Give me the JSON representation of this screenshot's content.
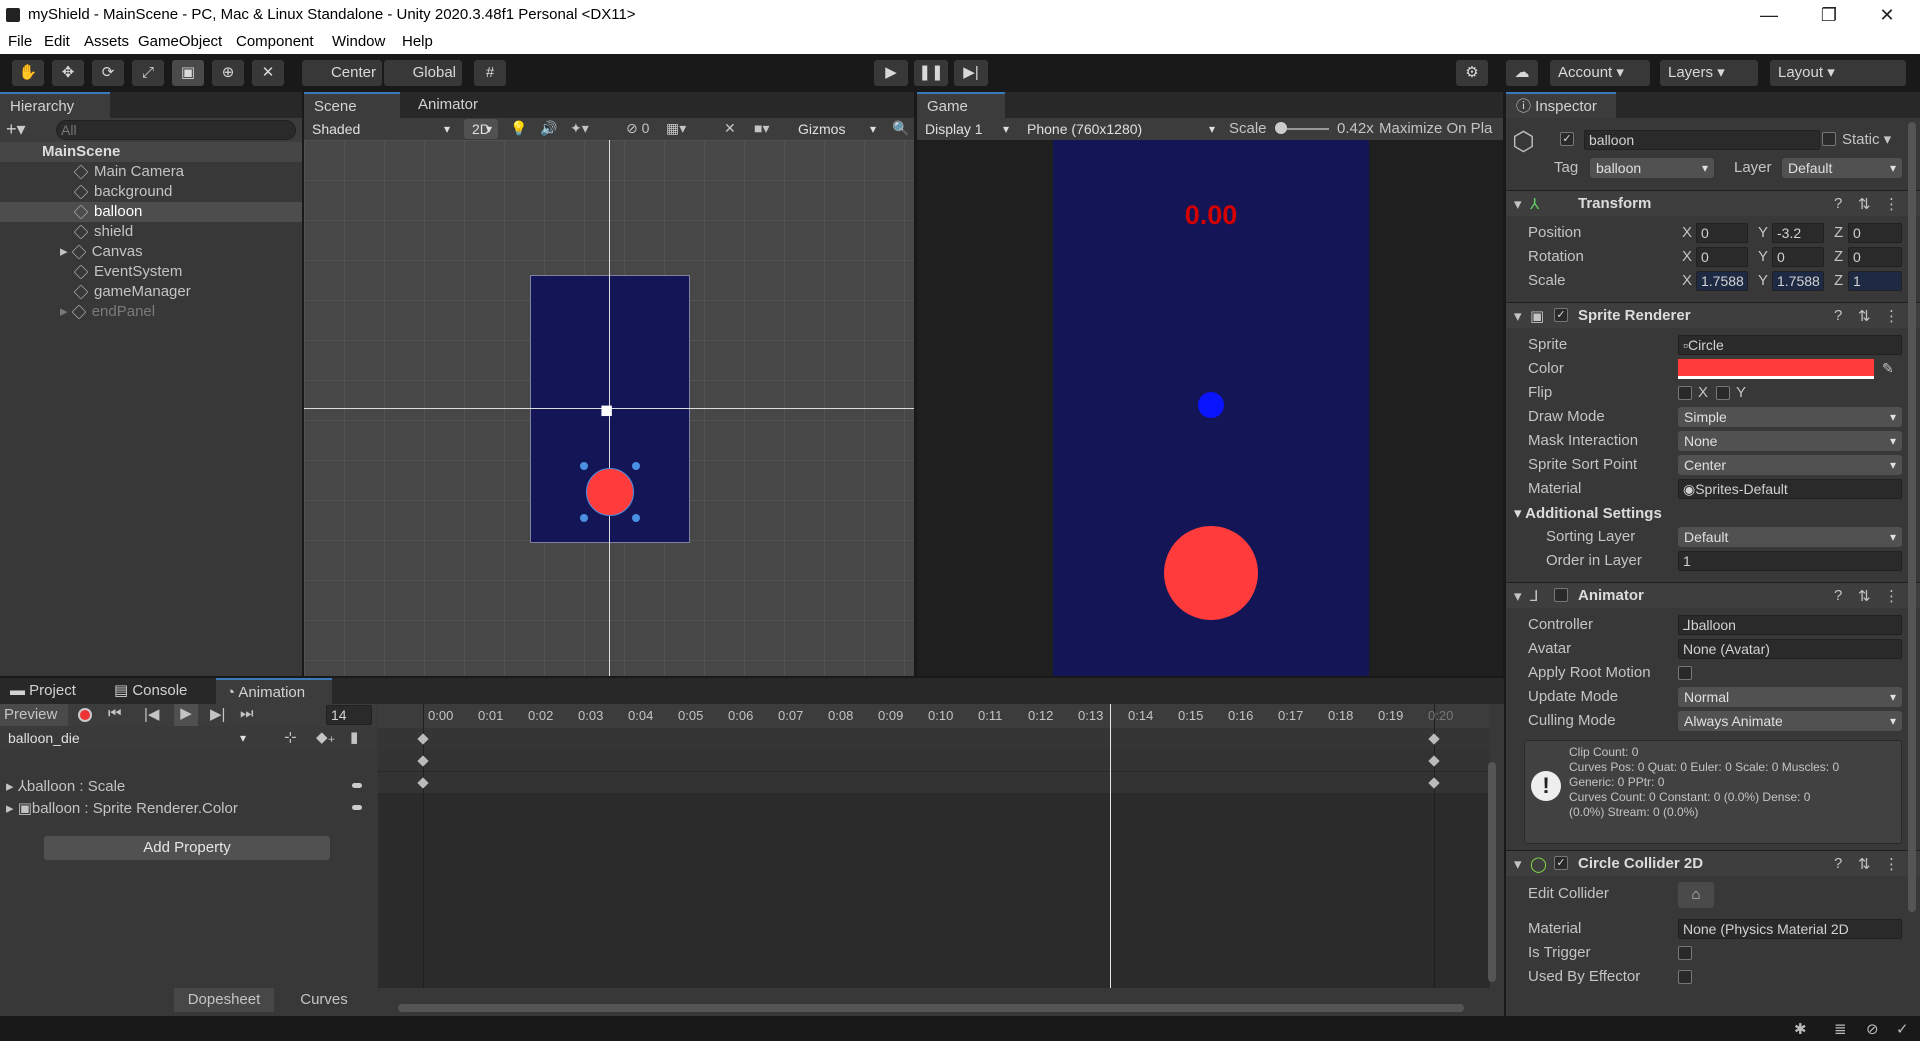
{
  "window": {
    "title": "myShield - MainScene - PC, Mac & Linux Standalone - Unity 2020.3.48f1 Personal <DX11>",
    "min": "—",
    "max": "❐",
    "close": "✕"
  },
  "menu": [
    "File",
    "Edit",
    "Assets",
    "GameObject",
    "Component",
    "Window",
    "Help"
  ],
  "toolbar": {
    "center": "Center",
    "global": "Global",
    "account": "Account",
    "layers": "Layers",
    "layout": "Layout"
  },
  "hierarchy": {
    "tab": "Hierarchy",
    "search_placeholder": "All",
    "scene": "MainScene",
    "items": [
      "Main Camera",
      "background",
      "balloon",
      "shield",
      "Canvas",
      "EventSystem",
      "gameManager",
      "endPanel"
    ]
  },
  "scene": {
    "tab": "Scene",
    "animator_tab": "Animator",
    "shading": "Shaded",
    "mode2d": "2D",
    "hidden_count": "0",
    "gizmos": "Gizmos"
  },
  "game": {
    "tab": "Game",
    "display": "Display 1",
    "resolution": "Phone (760x1280)",
    "scale_label": "Scale",
    "scale_value": "0.42x",
    "maximize": "Maximize On Pla",
    "score": "0.00"
  },
  "colors": {
    "game_bg": "#131557",
    "balloon": "#ff3b3b",
    "shield": "#0a14ff",
    "score": "#d40000"
  },
  "bottom": {
    "tabs": [
      "Project",
      "Console",
      "Animation"
    ],
    "preview": "Preview",
    "frame": "14",
    "clip": "balloon_die",
    "tracks": [
      "balloon : Scale",
      "balloon : Sprite Renderer.Color"
    ],
    "add_property": "Add Property",
    "dopesheet": "Dopesheet",
    "curves": "Curves",
    "ticks": [
      "0:00",
      "0:01",
      "0:02",
      "0:03",
      "0:04",
      "0:05",
      "0:06",
      "0:07",
      "0:08",
      "0:09",
      "0:10",
      "0:11",
      "0:12",
      "0:13",
      "0:14",
      "0:15",
      "0:16",
      "0:17",
      "0:18",
      "0:19",
      "0:20"
    ]
  },
  "inspector": {
    "tab": "Inspector",
    "name": "balloon",
    "static": "Static",
    "tag_label": "Tag",
    "tag": "balloon",
    "layer_label": "Layer",
    "layer": "Default",
    "transform": {
      "title": "Transform",
      "position": "Position",
      "rotation": "Rotation",
      "scale": "Scale",
      "px": "0",
      "py": "-3.2",
      "pz": "0",
      "rx": "0",
      "ry": "0",
      "rz": "0",
      "sx": "1.7588",
      "sy": "1.7588",
      "sz": "1"
    },
    "sprite_renderer": {
      "title": "Sprite Renderer",
      "sprite_label": "Sprite",
      "sprite": "Circle",
      "color_label": "Color",
      "flip_label": "Flip",
      "flip_x": "X",
      "flip_y": "Y",
      "draw_mode_label": "Draw Mode",
      "draw_mode": "Simple",
      "mask_label": "Mask Interaction",
      "mask": "None",
      "sort_point_label": "Sprite Sort Point",
      "sort_point": "Center",
      "material_label": "Material",
      "material": "Sprites-Default",
      "additional": "Additional Settings",
      "sorting_layer_label": "Sorting Layer",
      "sorting_layer": "Default",
      "order_label": "Order in Layer",
      "order": "1"
    },
    "animator": {
      "title": "Animator",
      "controller_label": "Controller",
      "controller": "balloon",
      "avatar_label": "Avatar",
      "avatar": "None (Avatar)",
      "root_motion": "Apply Root Motion",
      "update_label": "Update Mode",
      "update": "Normal",
      "culling_label": "Culling Mode",
      "culling": "Always Animate",
      "info": [
        "Clip Count: 0",
        "Curves Pos: 0 Quat: 0 Euler: 0 Scale: 0 Muscles: 0",
        "Generic: 0 PPtr: 0",
        "Curves Count: 0 Constant: 0 (0.0%) Dense: 0",
        "(0.0%) Stream: 0 (0.0%)"
      ]
    },
    "collider": {
      "title": "Circle Collider 2D",
      "edit_label": "Edit Collider",
      "material_label": "Material",
      "material": "None (Physics Material 2D",
      "trigger_label": "Is Trigger",
      "effector_label": "Used By Effector"
    }
  }
}
